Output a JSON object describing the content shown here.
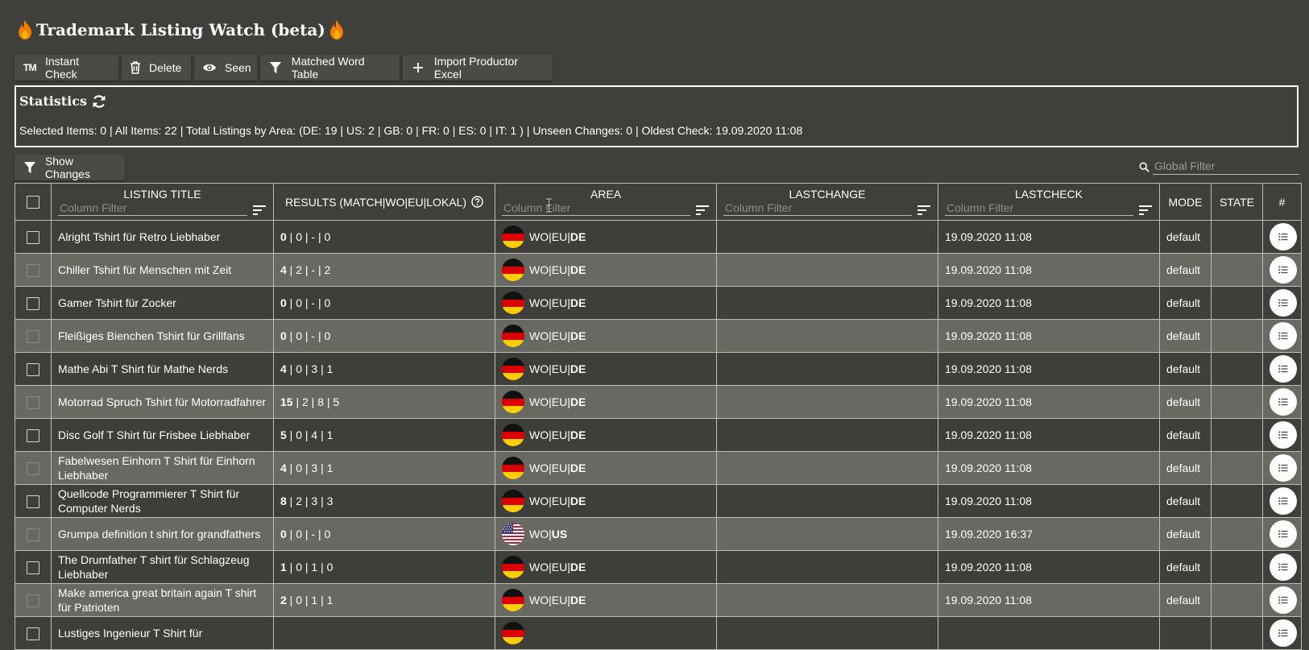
{
  "app": {
    "title": "Trademark Listing Watch (beta)"
  },
  "toolbar": {
    "instant_check": "Instant Check",
    "instant_check_icon": "TM",
    "delete": "Delete",
    "seen": "Seen",
    "matched_word_table": "Matched Word Table",
    "import_productor_excel": "Import Productor Excel"
  },
  "stats": {
    "title": "Statistics",
    "line": "Selected Items: 0 | All Items: 22 | Total Listings by Area: (DE: 19 | US: 2 | GB: 0 | FR: 0 | ES: 0 | IT: 1 ) | Unseen Changes: 0 | Oldest Check: 19.09.2020 11:08"
  },
  "filters": {
    "show_changes": "Show Changes",
    "global_placeholder": "Global Filter",
    "column_placeholder": "Column Filter"
  },
  "columns": {
    "listing_title": "LISTING TITLE",
    "results": "RESULTS (MATCH|WO|EU|LOKAL)",
    "area": "AREA",
    "lastchange": "LASTCHANGE",
    "lastcheck": "LASTCHECK",
    "mode": "MODE",
    "state": "STATE",
    "menu": "#"
  },
  "rows": [
    {
      "title": "Alright Tshirt für Retro Liebhaber",
      "match": "0",
      "rest": " | 0 | - | 0",
      "flag": "de",
      "area_prefix": "WO|EU|",
      "area_bold": "DE",
      "lastchange": "",
      "lastcheck": "19.09.2020 11:08",
      "mode": "default",
      "state": ""
    },
    {
      "title": "Chiller Tshirt für Menschen mit Zeit",
      "match": "4",
      "rest": " | 2 | - | 2",
      "flag": "de",
      "area_prefix": "WO|EU|",
      "area_bold": "DE",
      "lastchange": "",
      "lastcheck": "19.09.2020 11:08",
      "mode": "default",
      "state": ""
    },
    {
      "title": "Gamer Tshirt für Zocker",
      "match": "0",
      "rest": " | 0 | - | 0",
      "flag": "de",
      "area_prefix": "WO|EU|",
      "area_bold": "DE",
      "lastchange": "",
      "lastcheck": "19.09.2020 11:08",
      "mode": "default",
      "state": ""
    },
    {
      "title": "Fleißiges Bienchen Tshirt für Grillfans",
      "match": "0",
      "rest": " | 0 | - | 0",
      "flag": "de",
      "area_prefix": "WO|EU|",
      "area_bold": "DE",
      "lastchange": "",
      "lastcheck": "19.09.2020 11:08",
      "mode": "default",
      "state": ""
    },
    {
      "title": "Mathe Abi T Shirt für Mathe Nerds",
      "match": "4",
      "rest": " | 0 | 3 | 1",
      "flag": "de",
      "area_prefix": "WO|EU|",
      "area_bold": "DE",
      "lastchange": "",
      "lastcheck": "19.09.2020 11:08",
      "mode": "default",
      "state": ""
    },
    {
      "title": "Motorrad Spruch Tshirt für Motorradfahrer",
      "match": "15",
      "rest": " | 2 | 8 | 5",
      "flag": "de",
      "area_prefix": "WO|EU|",
      "area_bold": "DE",
      "lastchange": "",
      "lastcheck": "19.09.2020 11:08",
      "mode": "default",
      "state": ""
    },
    {
      "title": "Disc Golf T Shirt für Frisbee Liebhaber",
      "match": "5",
      "rest": " | 0 | 4 | 1",
      "flag": "de",
      "area_prefix": "WO|EU|",
      "area_bold": "DE",
      "lastchange": "",
      "lastcheck": "19.09.2020 11:08",
      "mode": "default",
      "state": ""
    },
    {
      "title": "Fabelwesen Einhorn T Shirt für Einhorn Liebhaber",
      "match": "4",
      "rest": " | 0 | 3 | 1",
      "flag": "de",
      "area_prefix": "WO|EU|",
      "area_bold": "DE",
      "lastchange": "",
      "lastcheck": "19.09.2020 11:08",
      "mode": "default",
      "state": ""
    },
    {
      "title": "Quellcode Programmierer T Shirt für Computer Nerds",
      "match": "8",
      "rest": " | 2 | 3 | 3",
      "flag": "de",
      "area_prefix": "WO|EU|",
      "area_bold": "DE",
      "lastchange": "",
      "lastcheck": "19.09.2020 11:08",
      "mode": "default",
      "state": ""
    },
    {
      "title": "Grumpa definition t shirt for grandfathers",
      "match": "0",
      "rest": " | 0 | - | 0",
      "flag": "us",
      "area_prefix": "WO|",
      "area_bold": "US",
      "lastchange": "",
      "lastcheck": "19.09.2020 16:37",
      "mode": "default",
      "state": ""
    },
    {
      "title": "The Drumfather T shirt für Schlagzeug Liebhaber",
      "match": "1",
      "rest": " | 0 | 1 | 0",
      "flag": "de",
      "area_prefix": "WO|EU|",
      "area_bold": "DE",
      "lastchange": "",
      "lastcheck": "19.09.2020 11:08",
      "mode": "default",
      "state": ""
    },
    {
      "title": "Make america great britain again T shirt für Patrioten",
      "match": "2",
      "rest": " | 0 | 1 | 1",
      "flag": "de",
      "area_prefix": "WO|EU|",
      "area_bold": "DE",
      "lastchange": "",
      "lastcheck": "19.09.2020 11:08",
      "mode": "default",
      "state": ""
    },
    {
      "title": "Lustiges Ingenieur T Shirt für",
      "match": "",
      "rest": "",
      "flag": "de",
      "area_prefix": "",
      "area_bold": "",
      "lastchange": "",
      "lastcheck": "",
      "mode": "",
      "state": ""
    }
  ],
  "colors": {
    "background": "#3f3f3b",
    "row_odd": "#3e3e3a",
    "row_even": "#696964",
    "border": "#bdbdb5",
    "flame": "#f57c00"
  }
}
